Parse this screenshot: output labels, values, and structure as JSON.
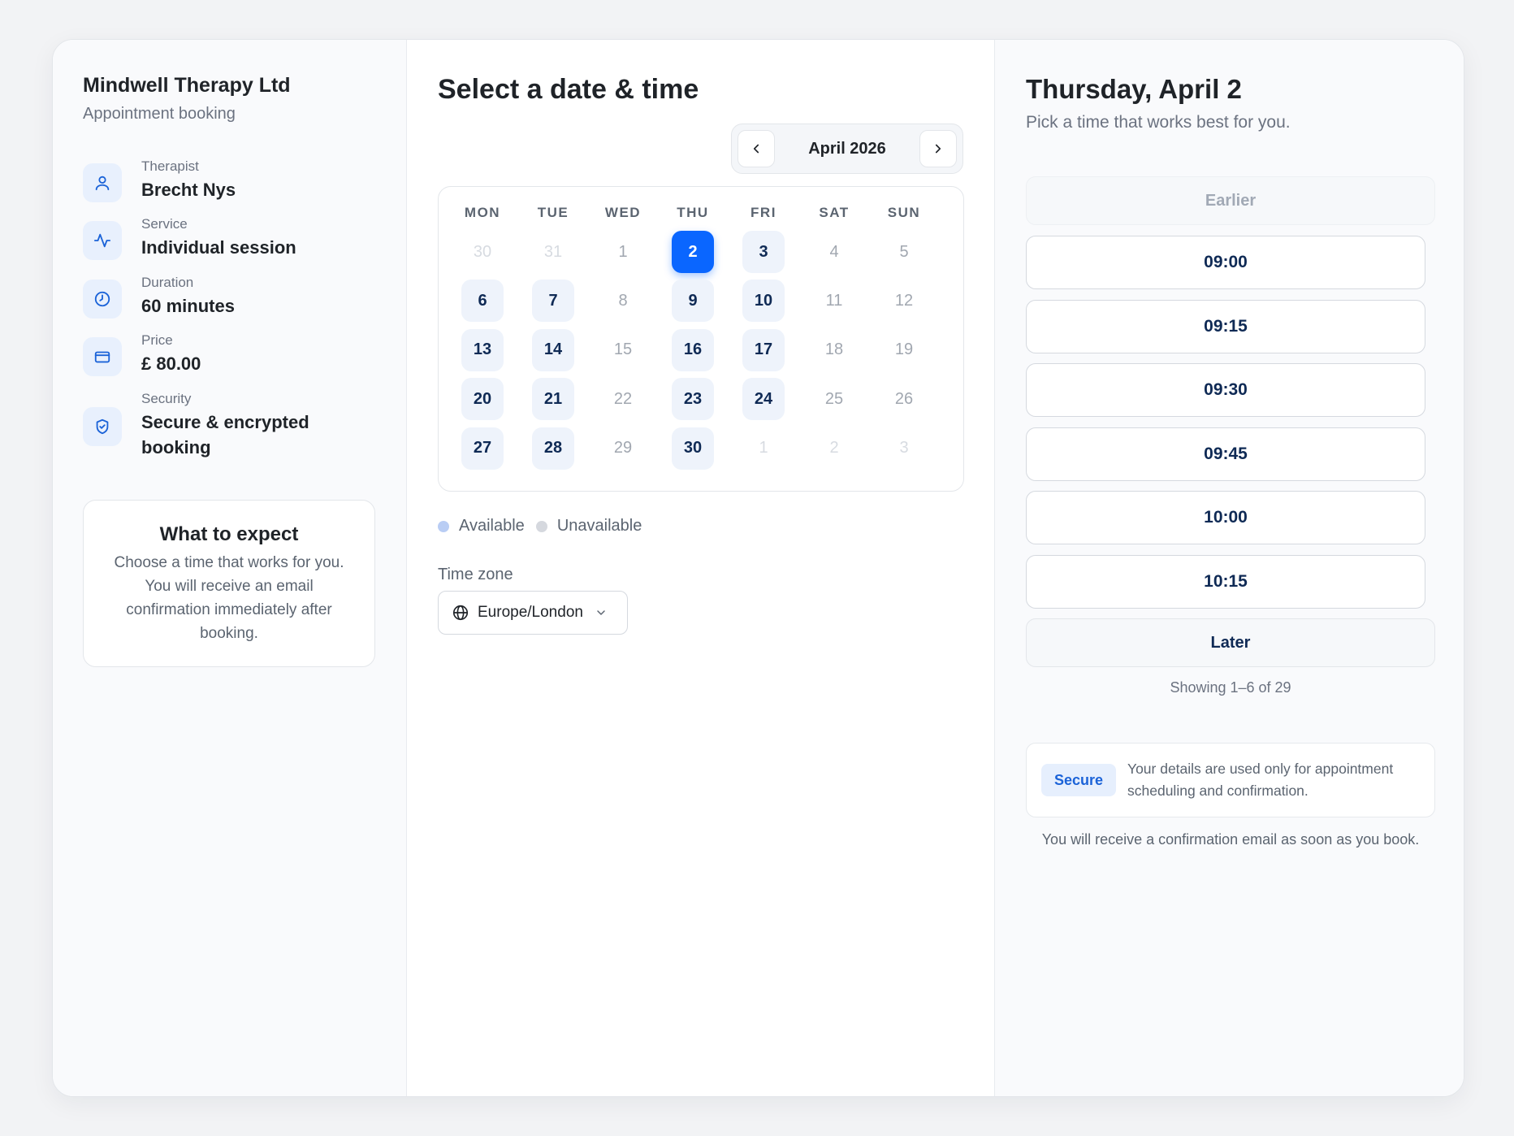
{
  "org": {
    "name": "Mindwell Therapy Ltd",
    "subtitle": "Appointment booking"
  },
  "details": [
    {
      "icon": "user-icon",
      "label": "Therapist",
      "value": "Brecht Nys"
    },
    {
      "icon": "activity-icon",
      "label": "Service",
      "value": "Individual session"
    },
    {
      "icon": "clock-icon",
      "label": "Duration",
      "value": "60 minutes"
    },
    {
      "icon": "credit-card-icon",
      "label": "Price",
      "value": "£ 80.00"
    },
    {
      "icon": "shield-check-icon",
      "label": "Security",
      "value": "Secure & encrypted booking"
    }
  ],
  "expect": {
    "title": "What to expect",
    "text": "Choose a time that works for you. You will receive an email confirmation immediately after booking."
  },
  "calendar": {
    "title": "Select a date & time",
    "month": "April 2026",
    "weekdays": [
      "MON",
      "TUE",
      "WED",
      "THU",
      "FRI",
      "SAT",
      "SUN"
    ],
    "weeks": [
      [
        {
          "d": "30",
          "s": "outside"
        },
        {
          "d": "31",
          "s": "outside"
        },
        {
          "d": "1",
          "s": "unavail"
        },
        {
          "d": "2",
          "s": "selected"
        },
        {
          "d": "3",
          "s": "avail"
        },
        {
          "d": "4",
          "s": "unavail"
        },
        {
          "d": "5",
          "s": "unavail"
        }
      ],
      [
        {
          "d": "6",
          "s": "avail"
        },
        {
          "d": "7",
          "s": "avail"
        },
        {
          "d": "8",
          "s": "unavail"
        },
        {
          "d": "9",
          "s": "avail"
        },
        {
          "d": "10",
          "s": "avail"
        },
        {
          "d": "11",
          "s": "unavail"
        },
        {
          "d": "12",
          "s": "unavail"
        }
      ],
      [
        {
          "d": "13",
          "s": "avail"
        },
        {
          "d": "14",
          "s": "avail"
        },
        {
          "d": "15",
          "s": "unavail"
        },
        {
          "d": "16",
          "s": "avail"
        },
        {
          "d": "17",
          "s": "avail"
        },
        {
          "d": "18",
          "s": "unavail"
        },
        {
          "d": "19",
          "s": "unavail"
        }
      ],
      [
        {
          "d": "20",
          "s": "avail"
        },
        {
          "d": "21",
          "s": "avail"
        },
        {
          "d": "22",
          "s": "unavail"
        },
        {
          "d": "23",
          "s": "avail"
        },
        {
          "d": "24",
          "s": "avail"
        },
        {
          "d": "25",
          "s": "unavail"
        },
        {
          "d": "26",
          "s": "unavail"
        }
      ],
      [
        {
          "d": "27",
          "s": "avail"
        },
        {
          "d": "28",
          "s": "avail"
        },
        {
          "d": "29",
          "s": "unavail"
        },
        {
          "d": "30",
          "s": "avail"
        },
        {
          "d": "1",
          "s": "outside"
        },
        {
          "d": "2",
          "s": "outside"
        },
        {
          "d": "3",
          "s": "outside"
        }
      ]
    ]
  },
  "legend": {
    "available": "Available",
    "unavailable": "Unavailable",
    "available_color": "#b9cdf4",
    "unavailable_color": "#d5d8de"
  },
  "timezone": {
    "label": "Time zone",
    "value": "Europe/London"
  },
  "times": {
    "title": "Thursday, April 2",
    "subtitle": "Pick a time that works best for you.",
    "earlier": "Earlier",
    "slots": [
      "09:00",
      "09:15",
      "09:30",
      "09:45",
      "10:00",
      "10:15"
    ],
    "later": "Later",
    "showing": "Showing 1–6 of 29"
  },
  "secure": {
    "badge": "Secure",
    "text": "Your details are used only for appointment scheduling and confirmation.",
    "confirm": "You will receive a confirmation email as soon as you book."
  },
  "colors": {
    "accent": "#0a66ff",
    "icon_bg": "#e8f0fd",
    "icon_stroke": "#1b63d8"
  }
}
